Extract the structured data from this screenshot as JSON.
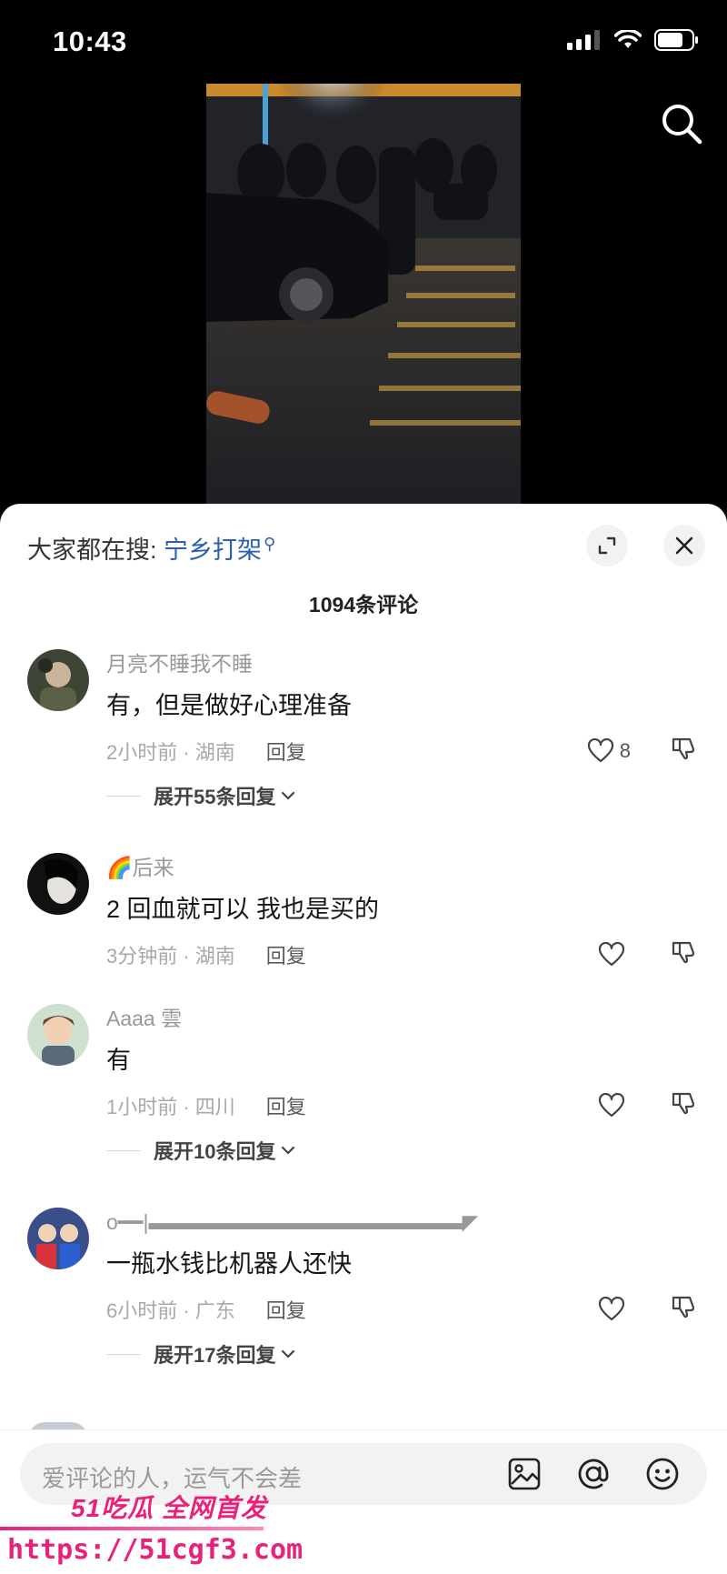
{
  "status": {
    "time": "10:43"
  },
  "hot_search": {
    "prefix": "大家都在搜:",
    "term": "宁乡打架"
  },
  "comment_count": "1094条评论",
  "comments": [
    {
      "user": "月亮不睡我不睡",
      "text": "有，但是做好心理准备",
      "time_loc": "2小时前 · 湖南",
      "reply": "回复",
      "likes": "8",
      "expand": "展开55条回复"
    },
    {
      "user": "🌈后来",
      "text": "2 回血就可以 我也是买的",
      "time_loc": "3分钟前 · 湖南",
      "reply": "回复",
      "likes": "",
      "expand": ""
    },
    {
      "user": "Aaaa 雲",
      "text": "有",
      "time_loc": "1小时前 · 四川",
      "reply": "回复",
      "likes": "",
      "expand": "展开10条回复"
    },
    {
      "user": "o━━|▬▬▬▬▬▬▬▬▬▬▬▬▬▬▬◤",
      "text": "一瓶水钱比机器人还快",
      "time_loc": "6小时前 · 广东",
      "reply": "回复",
      "likes": "",
      "expand": "展开17条回复"
    }
  ],
  "input": {
    "placeholder": "爱评论的人，运气不会差"
  },
  "watermark": {
    "logo": "51吃瓜 全网首发",
    "url": "https://51cgf3.com"
  },
  "colors": {
    "accent": "#2b5fb3",
    "watermark": "#e8227a"
  }
}
